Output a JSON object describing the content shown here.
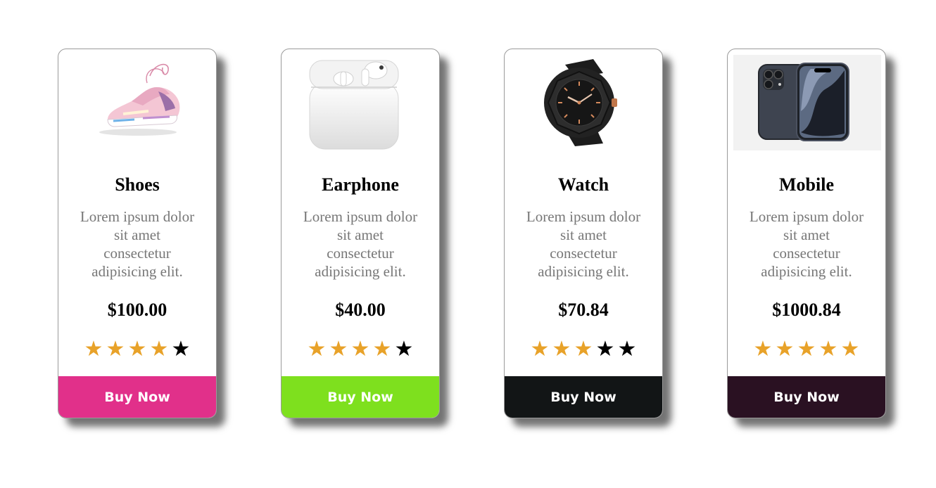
{
  "products": [
    {
      "name": "Shoes",
      "description": "Lorem ipsum dolor sit amet consectetur adipisicing elit.",
      "price": "$100.00",
      "rating": 4,
      "max_rating": 5,
      "button_label": "Buy Now",
      "button_color": "#e1308a",
      "image_icon": "sneaker-image"
    },
    {
      "name": "Earphone",
      "description": "Lorem ipsum dolor sit amet consectetur adipisicing elit.",
      "price": "$40.00",
      "rating": 4,
      "max_rating": 5,
      "button_label": "Buy Now",
      "button_color": "#7ee01e",
      "image_icon": "earbuds-image"
    },
    {
      "name": "Watch",
      "description": "Lorem ipsum dolor sit amet consectetur adipisicing elit.",
      "price": "$70.84",
      "rating": 3,
      "max_rating": 5,
      "button_label": "Buy Now",
      "button_color": "#121516",
      "image_icon": "watch-image"
    },
    {
      "name": "Mobile",
      "description": "Lorem ipsum dolor sit amet consectetur adipisicing elit.",
      "price": "$1000.84",
      "rating": 5,
      "max_rating": 5,
      "button_label": "Buy Now",
      "button_color": "#2a1122",
      "image_icon": "smartphone-image"
    }
  ],
  "colors": {
    "star_filled": "#e8a229",
    "star_empty": "#000000"
  }
}
